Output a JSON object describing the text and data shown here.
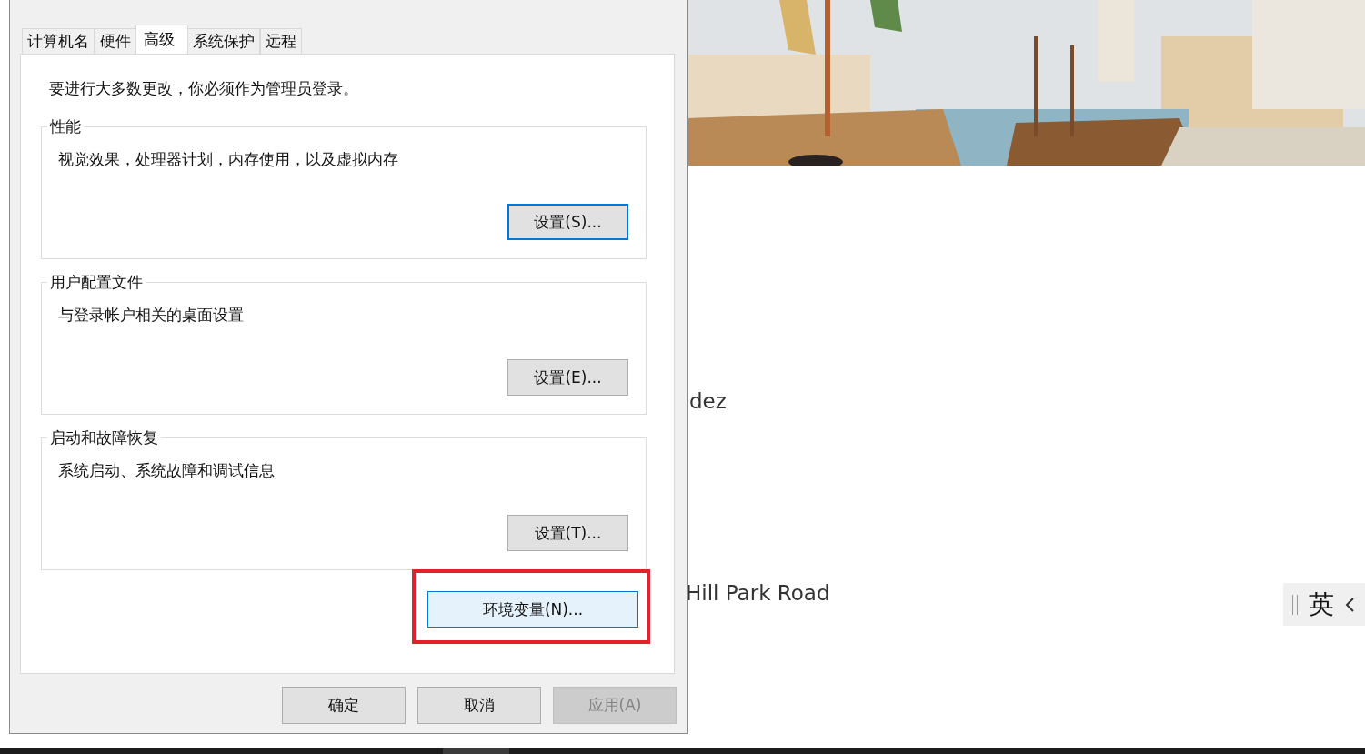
{
  "background_page": {
    "texts": [
      {
        "kind": "name",
        "text": "dez"
      },
      {
        "kind": "address",
        "text": "Hill Park Road"
      }
    ],
    "ime_indicator": {
      "label": "英"
    }
  },
  "dialog": {
    "tabs": [
      {
        "label": "计算机名",
        "selected": false
      },
      {
        "label": "硬件",
        "selected": false
      },
      {
        "label": "高级",
        "selected": true
      },
      {
        "label": "系统保护",
        "selected": false
      },
      {
        "label": "远程",
        "selected": false
      }
    ],
    "notice": "要进行大多数更改，你必须作为管理员登录。",
    "groups": [
      {
        "title": "性能",
        "description": "视觉效果，处理器计划，内存使用，以及虚拟内存",
        "button": {
          "label": "设置(S)...",
          "focused": true
        }
      },
      {
        "title": "用户配置文件",
        "description": "与登录帐户相关的桌面设置",
        "button": {
          "label": "设置(E)...",
          "focused": false
        }
      },
      {
        "title": "启动和故障恢复",
        "description": "系统启动、系统故障和调试信息",
        "button": {
          "label": "设置(T)...",
          "focused": false
        }
      }
    ],
    "env_button": {
      "label": "环境变量(N)...",
      "hovered": true,
      "highlighted": true
    },
    "buttons": [
      {
        "label": "确定",
        "disabled": false
      },
      {
        "label": "取消",
        "disabled": false
      },
      {
        "label": "应用(A)",
        "disabled": true
      }
    ]
  }
}
